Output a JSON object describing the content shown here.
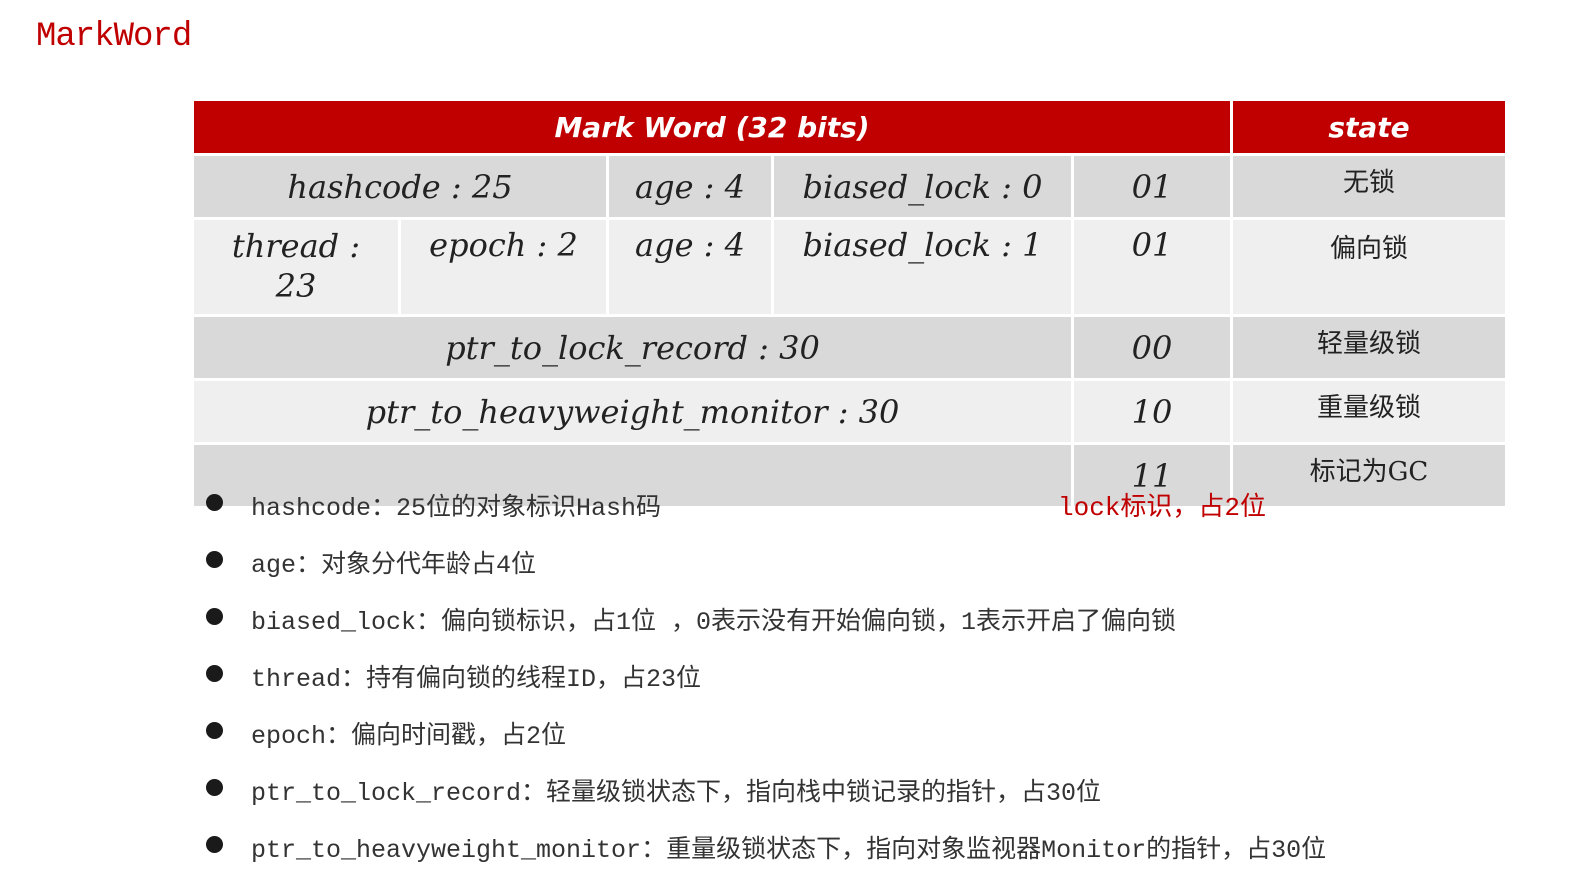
{
  "title": "MarkWord",
  "table": {
    "header": {
      "markword": "Mark Word (32 bits)",
      "state": "state"
    },
    "rows": [
      {
        "hashcode": "hashcode : 25",
        "age": "age : 4",
        "biased_lock": "biased_lock : 0",
        "lock": "01",
        "state": "无锁"
      },
      {
        "thread_line1": "thread :",
        "thread_line2": "23",
        "epoch": "epoch : 2",
        "age": "age : 4",
        "biased_lock": "biased_lock : 1",
        "lock": "01",
        "state": "偏向锁"
      },
      {
        "pointer": "ptr_to_lock_record : 30",
        "lock": "00",
        "state": "轻量级锁"
      },
      {
        "pointer": "ptr_to_heavyweight_monitor : 30",
        "lock": "10",
        "state": "重量级锁"
      },
      {
        "pointer": "",
        "lock": "11",
        "state": "标记为GC"
      }
    ]
  },
  "lock_note": "lock标识，占2位",
  "bullets": [
    "hashcode：25位的对象标识Hash码",
    "age：对象分代年龄占4位",
    "biased_lock：偏向锁标识，占1位 ，0表示没有开始偏向锁，1表示开启了偏向锁",
    "thread：持有偏向锁的线程ID，占23位",
    "epoch：偏向时间戳，占2位",
    "ptr_to_lock_record：轻量级锁状态下，指向栈中锁记录的指针，占30位",
    "ptr_to_heavyweight_monitor：重量级锁状态下，指向对象监视器Monitor的指针，占30位"
  ],
  "colors": {
    "accent": "#c00000",
    "row_dark": "#d9d9d9",
    "row_light": "#efefef"
  }
}
